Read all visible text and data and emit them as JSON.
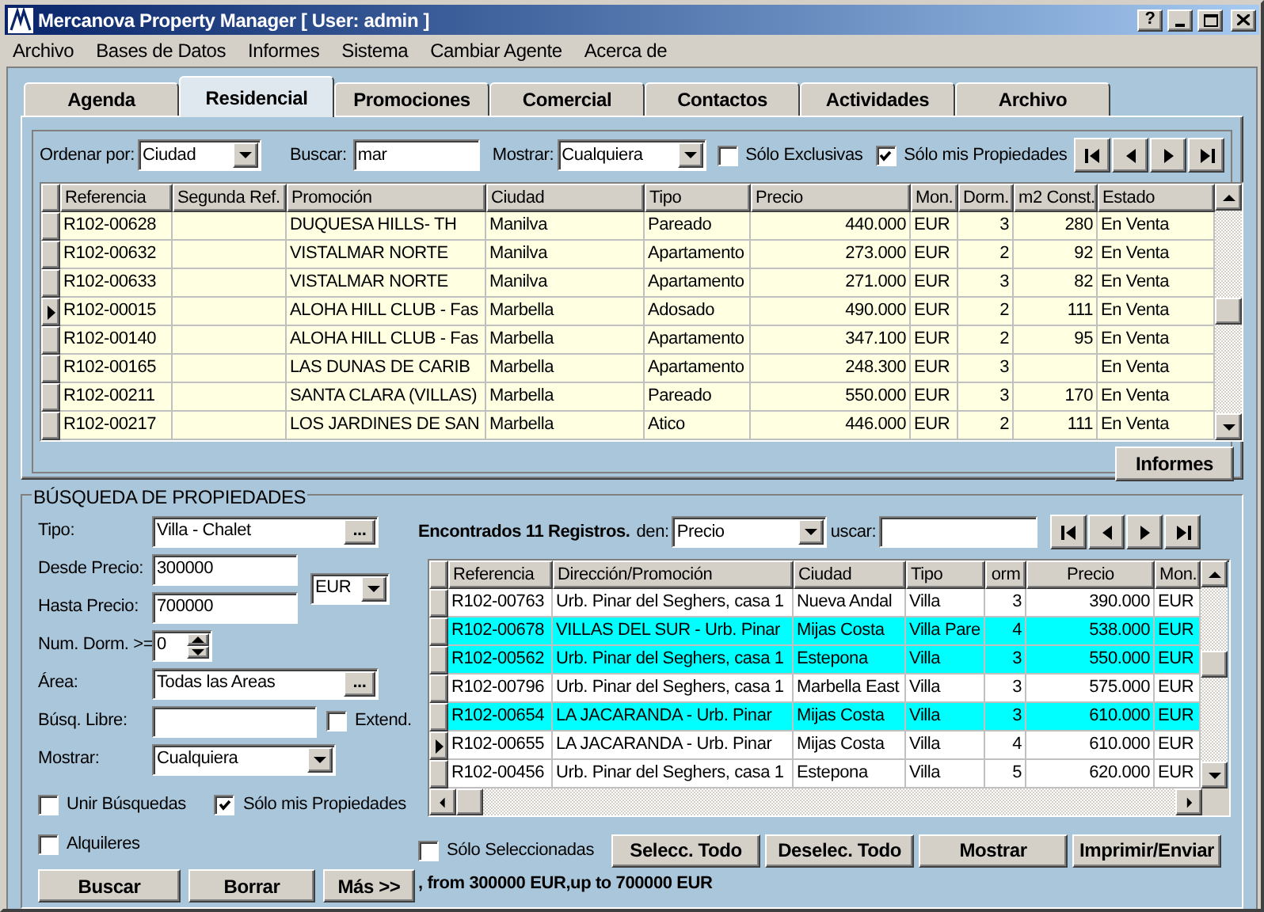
{
  "window": {
    "title": "Mercanova Property Manager [ User: admin ]",
    "help_button": "?"
  },
  "menu": [
    "Archivo",
    "Bases de Datos",
    "Informes",
    "Sistema",
    "Cambiar Agente",
    "Acerca de"
  ],
  "tabs": [
    {
      "label": "Agenda",
      "selected": false
    },
    {
      "label": "Residencial",
      "selected": true
    },
    {
      "label": "Promociones",
      "selected": false
    },
    {
      "label": "Comercial",
      "selected": false
    },
    {
      "label": "Contactos",
      "selected": false
    },
    {
      "label": "Actividades",
      "selected": false
    },
    {
      "label": "Archivo",
      "selected": false
    }
  ],
  "list_toolbar": {
    "sort_label": "Ordenar por:",
    "sort_value": "Ciudad",
    "search_label": "Buscar:",
    "search_value": "mar",
    "show_label": "Mostrar:",
    "show_value": "Cualquiera",
    "checkboxes": [
      {
        "label": "Sólo Exclusivas",
        "checked": false
      },
      {
        "label": "Sólo mis Propiedades",
        "checked": true
      }
    ]
  },
  "properties_table": {
    "columns": [
      "Referencia",
      "Segunda Ref.",
      "Promoción",
      "Ciudad",
      "Tipo",
      "Precio",
      "Mon.",
      "Dorm.",
      "m2 Const.",
      "Estado"
    ],
    "rows": [
      {
        "selected": false,
        "cells": [
          "R102-00628",
          "",
          "DUQUESA HILLS- TH",
          "Manilva",
          "Pareado",
          "440.000",
          "EUR",
          "3",
          "280",
          "En Venta"
        ]
      },
      {
        "selected": false,
        "cells": [
          "R102-00632",
          "",
          "VISTALMAR NORTE",
          "Manilva",
          "Apartamento",
          "273.000",
          "EUR",
          "2",
          "92",
          "En Venta"
        ]
      },
      {
        "selected": false,
        "cells": [
          "R102-00633",
          "",
          "VISTALMAR NORTE",
          "Manilva",
          "Apartamento",
          "271.000",
          "EUR",
          "3",
          "82",
          "En Venta"
        ]
      },
      {
        "selected": true,
        "cells": [
          "R102-00015",
          "",
          "ALOHA HILL CLUB - Fas",
          "Marbella",
          "Adosado",
          "490.000",
          "EUR",
          "2",
          "111",
          "En Venta"
        ]
      },
      {
        "selected": false,
        "cells": [
          "R102-00140",
          "",
          "ALOHA HILL CLUB - Fas",
          "Marbella",
          "Apartamento",
          "347.100",
          "EUR",
          "2",
          "95",
          "En Venta"
        ]
      },
      {
        "selected": false,
        "cells": [
          "R102-00165",
          "",
          "LAS DUNAS DE CARIB",
          "Marbella",
          "Apartamento",
          "248.300",
          "EUR",
          "3",
          "",
          "En Venta"
        ]
      },
      {
        "selected": false,
        "cells": [
          "R102-00211",
          "",
          "SANTA CLARA (VILLAS)",
          "Marbella",
          "Pareado",
          "550.000",
          "EUR",
          "3",
          "170",
          "En Venta"
        ]
      },
      {
        "selected": false,
        "cells": [
          "R102-00217",
          "",
          "LOS JARDINES DE SAN",
          "Marbella",
          "Atico",
          "446.000",
          "EUR",
          "2",
          "111",
          "En Venta"
        ]
      }
    ]
  },
  "reports_button": "Informes",
  "search_panel": {
    "title": "BÚSQUEDA DE PROPIEDADES",
    "tipo": {
      "label": "Tipo:",
      "value": "Villa - Chalet",
      "button": "..."
    },
    "desde": {
      "label": "Desde Precio:",
      "value": "300000"
    },
    "hasta": {
      "label": "Hasta Precio:",
      "value": "700000"
    },
    "currency": "EUR",
    "dorm": {
      "label": "Num. Dorm. >=",
      "value": "0"
    },
    "area": {
      "label": "Área:",
      "value": "Todas las Areas",
      "button": "..."
    },
    "libre": {
      "label": "Búsq. Libre:"
    },
    "extend": {
      "label": "Extend.",
      "checked": false
    },
    "mostrar": {
      "label": "Mostrar:",
      "value": "Cualquiera"
    },
    "checkboxes": [
      {
        "label": "Unir Búsquedas",
        "checked": false
      },
      {
        "label": "Sólo mis Propiedades",
        "checked": true
      },
      {
        "label": "Alquileres",
        "checked": false
      }
    ],
    "buttons": [
      "Buscar",
      "Borrar",
      "Más >>"
    ]
  },
  "results": {
    "summary": "Encontrados 11 Registros.",
    "order_label": "den:",
    "order_value": "Precio",
    "search_label": "uscar:",
    "table": {
      "columns": [
        "Referencia",
        "Dirección/Promoción",
        "Ciudad",
        "Tipo",
        "orm",
        "Precio",
        "Mon."
      ],
      "rows": [
        {
          "selected": false,
          "highlighted": false,
          "cells": [
            "R102-00763",
            "Urb. Pinar del Seghers, casa 1",
            "Nueva Andal",
            "Villa",
            "3",
            "390.000",
            "EUR"
          ]
        },
        {
          "selected": false,
          "highlighted": true,
          "cells": [
            "R102-00678",
            "VILLAS DEL SUR - Urb. Pinar",
            "Mijas Costa",
            "Villa Pare",
            "4",
            "538.000",
            "EUR"
          ]
        },
        {
          "selected": false,
          "highlighted": true,
          "cells": [
            "R102-00562",
            "Urb. Pinar del Seghers, casa 1",
            "Estepona",
            "Villa",
            "3",
            "550.000",
            "EUR"
          ]
        },
        {
          "selected": false,
          "highlighted": false,
          "cells": [
            "R102-00796",
            "Urb. Pinar del Seghers, casa 1",
            "Marbella East",
            "Villa",
            "3",
            "575.000",
            "EUR"
          ]
        },
        {
          "selected": false,
          "highlighted": true,
          "cells": [
            "R102-00654",
            "LA  JACARANDA - Urb. Pinar",
            "Mijas Costa",
            "Villa",
            "3",
            "610.000",
            "EUR"
          ]
        },
        {
          "selected": true,
          "highlighted": false,
          "cells": [
            "R102-00655",
            "LA  JACARANDA - Urb. Pinar",
            "Mijas Costa",
            "Villa",
            "4",
            "610.000",
            "EUR"
          ]
        },
        {
          "selected": false,
          "highlighted": false,
          "cells": [
            "R102-00456",
            "Urb. Pinar del Seghers, casa 1",
            "Estepona",
            "Villa",
            "5",
            "620.000",
            "EUR"
          ]
        }
      ]
    },
    "only_selected": {
      "label": "Sólo Seleccionadas",
      "checked": false
    },
    "buttons": [
      "Selecc. Todo",
      "Deselec. Todo",
      "Mostrar",
      "Imprimir/Enviar"
    ],
    "criteria": ", from 300000 EUR,up to 700000 EUR"
  }
}
